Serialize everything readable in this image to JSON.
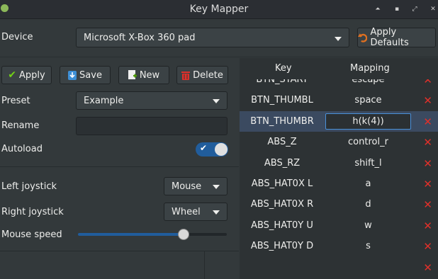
{
  "window": {
    "title": "Key Mapper"
  },
  "device": {
    "label": "Device",
    "selected": "Microsoft X-Box 360 pad",
    "apply_defaults_label": "Apply Defaults"
  },
  "toolbar": {
    "apply_label": "Apply",
    "save_label": "Save",
    "new_label": "New",
    "delete_label": "Delete"
  },
  "preset": {
    "label": "Preset",
    "selected": "Example",
    "rename_label": "Rename",
    "rename_value": "",
    "autoload_label": "Autoload",
    "autoload_on": true
  },
  "joysticks": {
    "left_label": "Left joystick",
    "left_value": "Mouse",
    "right_label": "Right joystick",
    "right_value": "Wheel",
    "mouse_speed_label": "Mouse speed",
    "mouse_speed_fraction": 0.71
  },
  "mapping_table": {
    "key_header": "Key",
    "mapping_header": "Mapping",
    "rows": [
      {
        "key": "BTN_START",
        "mapping": "escape"
      },
      {
        "key": "BTN_THUMBL",
        "mapping": "space"
      },
      {
        "key": "BTN_THUMBR",
        "mapping": "h(k(4))",
        "selected": true
      },
      {
        "key": "ABS_Z",
        "mapping": "control_r"
      },
      {
        "key": "ABS_RZ",
        "mapping": "shift_l"
      },
      {
        "key": "ABS_HAT0X L",
        "mapping": "a"
      },
      {
        "key": "ABS_HAT0X R",
        "mapping": "d"
      },
      {
        "key": "ABS_HAT0Y U",
        "mapping": "w"
      },
      {
        "key": "ABS_HAT0Y D",
        "mapping": "s"
      },
      {
        "key": "",
        "mapping": ""
      }
    ]
  },
  "colors": {
    "accent": "#215d9c",
    "delete_icon": "#e0302a",
    "selected_row": "#3b4a60"
  }
}
